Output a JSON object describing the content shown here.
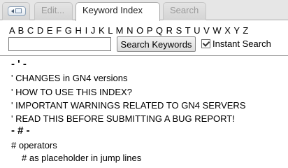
{
  "tabs": {
    "menu_icon": "tab-menu-icon",
    "edit": "Edit...",
    "keyword_index": "Keyword Index",
    "search": "Search"
  },
  "alphabet": [
    "A",
    "B",
    "C",
    "D",
    "E",
    "F",
    "G",
    "H",
    "I",
    "J",
    "K",
    "L",
    "M",
    "N",
    "O",
    "P",
    "Q",
    "R",
    "S",
    "T",
    "U",
    "V",
    "W",
    "X",
    "Y",
    "Z"
  ],
  "search": {
    "input_value": "",
    "button_label": "Search Keywords",
    "instant_label": "Instant Search",
    "instant_checked": true
  },
  "results": {
    "group1": {
      "header": "- ' -",
      "entries": [
        "' CHANGES in GN4 versions",
        "' HOW TO USE THIS INDEX?",
        "' IMPORTANT WARNINGS RELATED TO GN4 SERVERS",
        "' READ THIS BEFORE SUBMITTING A BUG REPORT!"
      ]
    },
    "group2": {
      "header": "- # -",
      "entries": [
        "# operators",
        "# as placeholder in jump lines"
      ]
    }
  },
  "colors": {
    "tab_inactive_text": "#9a9a9a",
    "tab_active_bg": "#ffffff",
    "tabbar_bg": "#e6e6e6"
  }
}
